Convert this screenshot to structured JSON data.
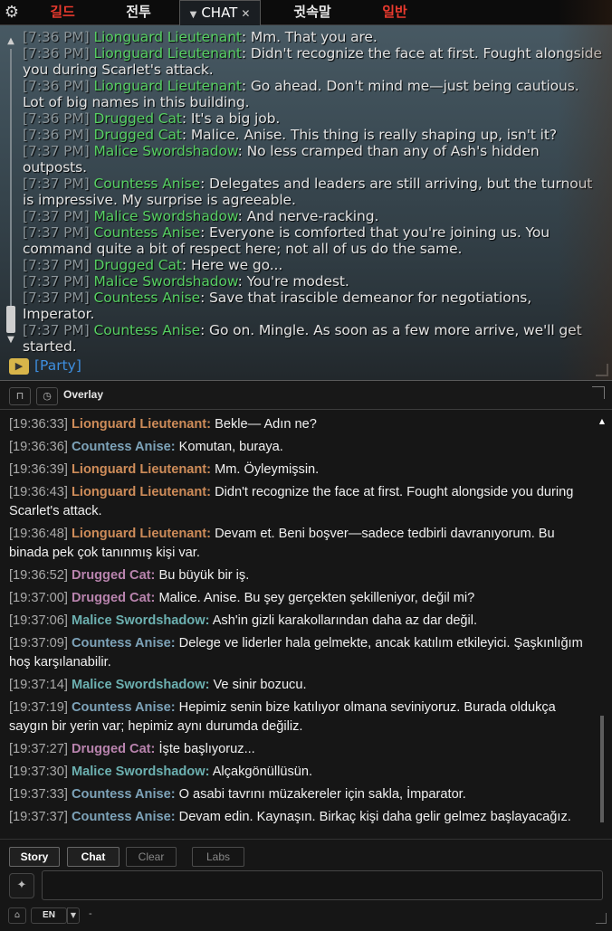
{
  "game_chat": {
    "tabs": [
      {
        "label": "길드",
        "color": "#e83a2e"
      },
      {
        "label": "전투",
        "color": "#e8e8e8"
      },
      {
        "label": "CHAT",
        "color": "#ffffff",
        "active": true
      },
      {
        "label": "귓속말",
        "color": "#e8e8e8"
      },
      {
        "label": "일반",
        "color": "#e83a2e"
      }
    ],
    "lines": [
      {
        "ts": "[7:36 PM]",
        "speaker": "Lionguard Lieutenant",
        "text": ": Mm. That you are."
      },
      {
        "ts": "[7:36 PM]",
        "speaker": "Lionguard Lieutenant",
        "text": ": Didn't recognize the face at first. Fought alongside you during Scarlet's attack."
      },
      {
        "ts": "[7:36 PM]",
        "speaker": "Lionguard Lieutenant",
        "text": ": Go ahead. Don't mind me—just being cautious. Lot of big names in this building."
      },
      {
        "ts": "[7:36 PM]",
        "speaker": "Drugged Cat",
        "text": ": It's a big job."
      },
      {
        "ts": "[7:36 PM]",
        "speaker": "Drugged Cat",
        "text": ": Malice. Anise. This thing is really shaping up, isn't it?"
      },
      {
        "ts": "[7:37 PM]",
        "speaker": "Malice Swordshadow",
        "text": ": No less cramped than any of Ash's hidden outposts."
      },
      {
        "ts": "[7:37 PM]",
        "speaker": "Countess Anise",
        "text": ": Delegates and leaders are still arriving, but the turnout is impressive. My surprise is agreeable."
      },
      {
        "ts": "[7:37 PM]",
        "speaker": "Malice Swordshadow",
        "text": ": And nerve-racking."
      },
      {
        "ts": "[7:37 PM]",
        "speaker": "Countess Anise",
        "text": ": Everyone is comforted that you're joining us. You command quite a bit of respect here; not all of us do the same."
      },
      {
        "ts": "[7:37 PM]",
        "speaker": "Drugged Cat",
        "text": ": Here we go..."
      },
      {
        "ts": "[7:37 PM]",
        "speaker": "Malice Swordshadow",
        "text": ": You're modest."
      },
      {
        "ts": "[7:37 PM]",
        "speaker": "Countess Anise",
        "text": ": Save that irascible demeanor for negotiations, Imperator."
      },
      {
        "ts": "[7:37 PM]",
        "speaker": "Countess Anise",
        "text": ": Go on. Mingle. As soon as a few more arrive, we'll get started."
      }
    ],
    "channel_label": "[Party]",
    "colors": {
      "timestamp": "#8a9499",
      "speaker": "#57d063",
      "text": "#e3e3e3",
      "channel": "#3e8fe0"
    }
  },
  "overlay": {
    "title": "Overlay",
    "messages": [
      {
        "ts": "[19:36:33]",
        "speaker": "Lionguard Lieutenant:",
        "cls": "sp-lion",
        "text": "Bekle— Adın ne?"
      },
      {
        "ts": "[19:36:36]",
        "speaker": "Countess Anise:",
        "cls": "sp-countess",
        "text": "Komutan, buraya."
      },
      {
        "ts": "[19:36:39]",
        "speaker": "Lionguard Lieutenant:",
        "cls": "sp-lion",
        "text": "Mm. Öyleymişsin."
      },
      {
        "ts": "[19:36:43]",
        "speaker": "Lionguard Lieutenant:",
        "cls": "sp-lion",
        "text": "Didn't recognize the face at first. Fought alongside you during Scarlet's attack."
      },
      {
        "ts": "[19:36:48]",
        "speaker": "Lionguard Lieutenant:",
        "cls": "sp-lion",
        "text": "Devam et. Beni boşver—sadece tedbirli davranıyorum. Bu binada pek çok tanınmış kişi var."
      },
      {
        "ts": "[19:36:52]",
        "speaker": "Drugged Cat:",
        "cls": "sp-drugged",
        "text": "Bu büyük bir iş."
      },
      {
        "ts": "[19:37:00]",
        "speaker": "Drugged Cat:",
        "cls": "sp-drugged",
        "text": "Malice. Anise. Bu şey gerçekten şekilleniyor, değil mi?"
      },
      {
        "ts": "[19:37:06]",
        "speaker": "Malice Swordshadow:",
        "cls": "sp-malice",
        "text": "Ash'in gizli karakollarından daha az dar değil."
      },
      {
        "ts": "[19:37:09]",
        "speaker": "Countess Anise:",
        "cls": "sp-countess",
        "text": "Delege ve liderler hala gelmekte, ancak katılım etkileyici. Şaşkınlığım hoş karşılanabilir."
      },
      {
        "ts": "[19:37:14]",
        "speaker": "Malice Swordshadow:",
        "cls": "sp-malice",
        "text": "Ve sinir bozucu."
      },
      {
        "ts": "[19:37:19]",
        "speaker": "Countess Anise:",
        "cls": "sp-countess",
        "text": "Hepimiz senin bize katılıyor olmana seviniyoruz. Burada oldukça saygın bir yerin var; hepimiz aynı durumda değiliz."
      },
      {
        "ts": "[19:37:27]",
        "speaker": "Drugged Cat:",
        "cls": "sp-drugged",
        "text": "İşte başlıyoruz..."
      },
      {
        "ts": "[19:37:30]",
        "speaker": "Malice Swordshadow:",
        "cls": "sp-malice",
        "text": "Alçakgönüllüsün."
      },
      {
        "ts": "[19:37:33]",
        "speaker": "Countess Anise:",
        "cls": "sp-countess",
        "text": "O asabi tavrını müzakereler için sakla, İmparator."
      },
      {
        "ts": "[19:37:37]",
        "speaker": "Countess Anise:",
        "cls": "sp-countess",
        "text": "Devam edin. Kaynaşın. Birkaç kişi daha gelir gelmez başlayacağız."
      }
    ],
    "tabs": [
      {
        "label": "Story",
        "active": true
      },
      {
        "label": "Chat",
        "active": true
      },
      {
        "label": "Clear",
        "active": false
      },
      {
        "label": "Labs",
        "active": false
      }
    ],
    "input_value": "",
    "language": "EN",
    "language_suffix": "-",
    "colors": {
      "lionguard": "#ce8c59",
      "countess": "#7da3b9",
      "drugged": "#b883ad",
      "malice": "#6cb0b0",
      "timestamp": "#a9a9a9"
    }
  }
}
